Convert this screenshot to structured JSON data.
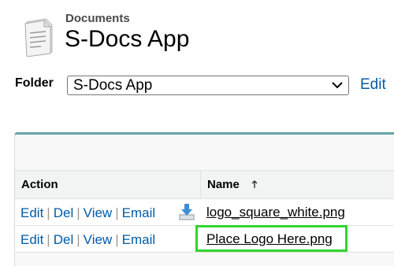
{
  "header": {
    "object_type": "Documents",
    "title": "S-Docs App",
    "icon": "document-icon"
  },
  "folder": {
    "label": "Folder",
    "selected": "S-Docs App",
    "edit_link": "Edit"
  },
  "table": {
    "columns": [
      {
        "label": "Action"
      },
      {
        "label": "Name",
        "sort": "ascending"
      }
    ],
    "rows": [
      {
        "actions": [
          "Edit",
          "Del",
          "View",
          "Email"
        ],
        "icon": "download-icon",
        "name": "logo_square_white.png"
      },
      {
        "actions": [
          "Edit",
          "Del",
          "View",
          "Email"
        ],
        "name": "Place Logo Here.png",
        "highlighted": true
      }
    ]
  },
  "colors": {
    "link": "#015ba7",
    "table_accent": "#66a3a8",
    "highlight": "#2ed62e"
  }
}
